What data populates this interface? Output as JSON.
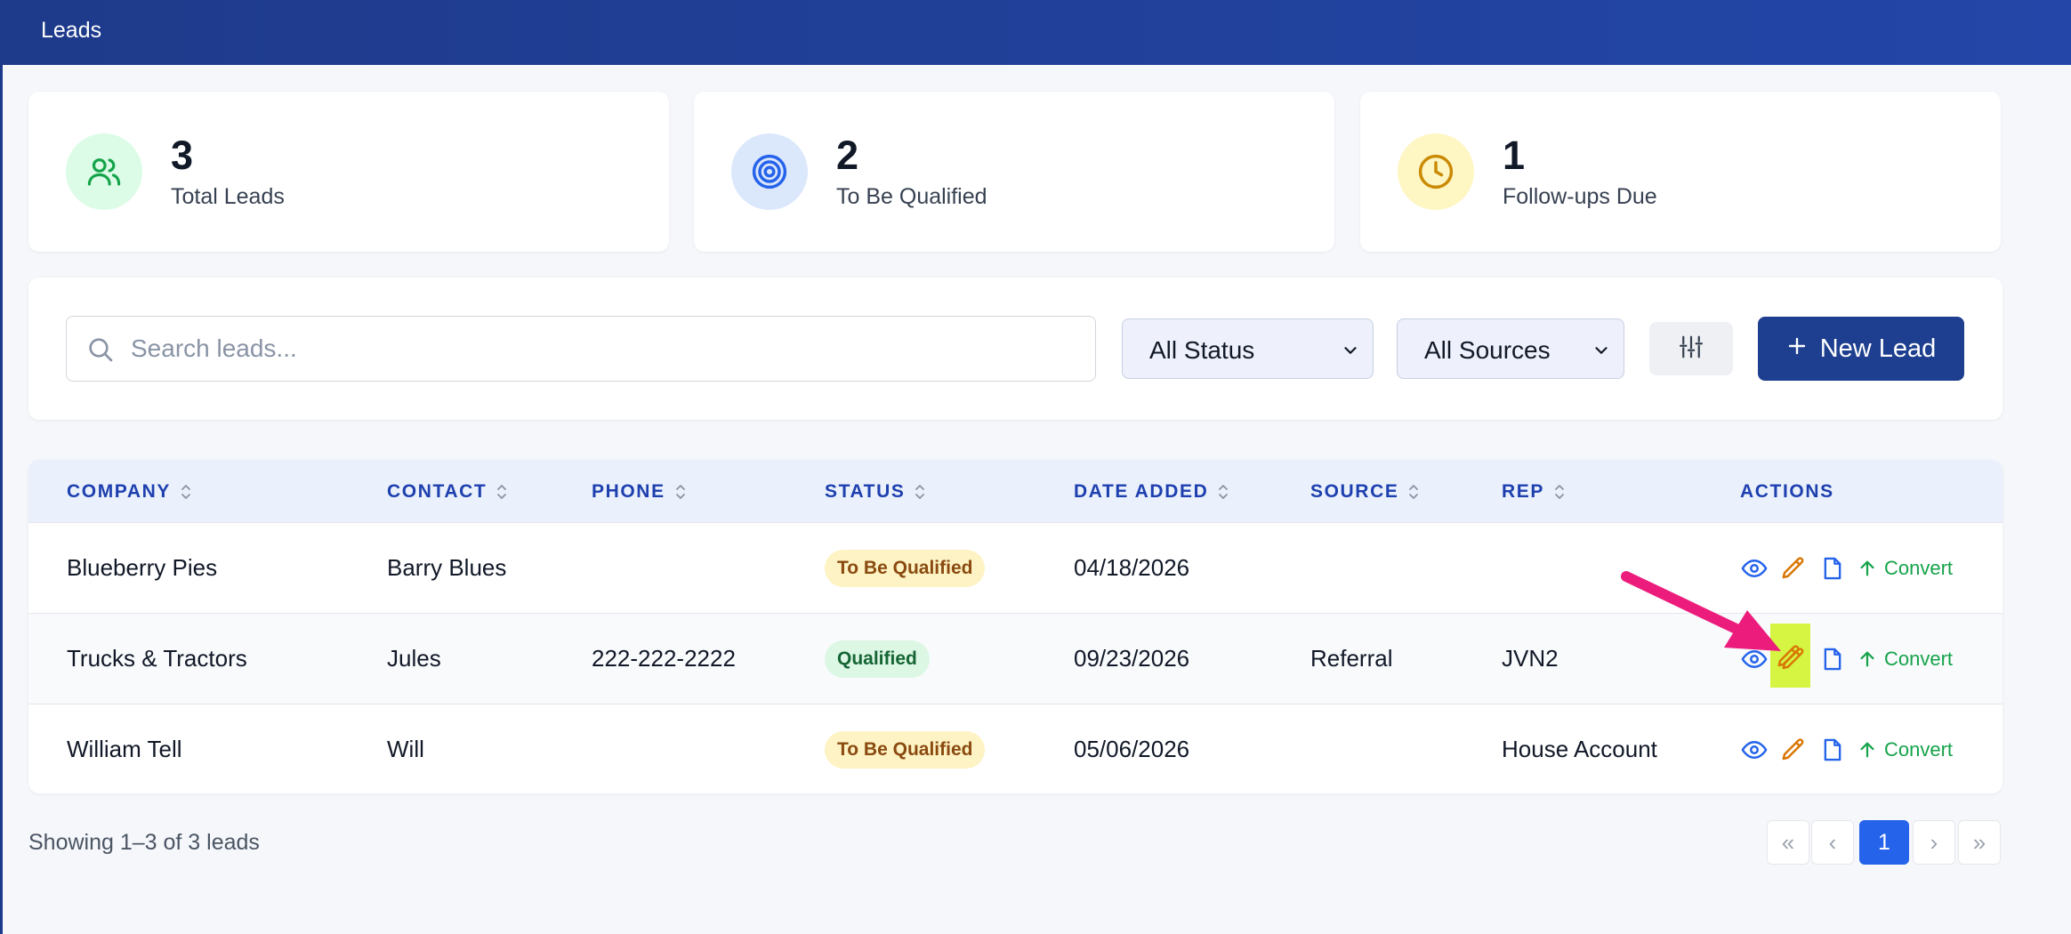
{
  "header": {
    "title": "Leads"
  },
  "stats": [
    {
      "value": "3",
      "label": "Total Leads",
      "icon": "users-icon",
      "bg": "#dcfce7",
      "fg": "#16a34a"
    },
    {
      "value": "2",
      "label": "To Be Qualified",
      "icon": "target-icon",
      "bg": "#dbe7fb",
      "fg": "#2563eb"
    },
    {
      "value": "1",
      "label": "Follow-ups Due",
      "icon": "clock-icon",
      "bg": "#fef6c3",
      "fg": "#ca8a04"
    }
  ],
  "filters": {
    "search_placeholder": "Search leads...",
    "status_selected": "All Status",
    "source_selected": "All Sources",
    "new_lead_label": "New Lead"
  },
  "table": {
    "columns": [
      "COMPANY",
      "CONTACT",
      "PHONE",
      "STATUS",
      "DATE ADDED",
      "SOURCE",
      "REP",
      "ACTIONS"
    ],
    "rows": [
      {
        "company": "Blueberry Pies",
        "contact": "Barry Blues",
        "phone": "",
        "status": "To Be Qualified",
        "date": "04/18/2026",
        "source": "",
        "rep": "",
        "convert": "Convert"
      },
      {
        "company": "Trucks & Tractors",
        "contact": "Jules",
        "phone": "222-222-2222",
        "status": "Qualified",
        "date": "09/23/2026",
        "source": "Referral",
        "rep": "JVN2",
        "convert": "Convert"
      },
      {
        "company": "William Tell",
        "contact": "Will",
        "phone": "",
        "status": "To Be Qualified",
        "date": "05/06/2026",
        "source": "",
        "rep": "House Account",
        "convert": "Convert"
      }
    ]
  },
  "footer": {
    "summary": "Showing 1–3 of 3 leads",
    "pager": {
      "first": "«",
      "prev": "‹",
      "current": "1",
      "next": "›",
      "last": "»"
    }
  },
  "colors": {
    "header": "#1e3a8a",
    "primary_button": "#1e3f8f",
    "column_header_text": "#1e40af",
    "convert": "#16a34a",
    "edit_icon": "#d97706",
    "highlight": "#d6f542",
    "annotation_arrow": "#ec1c7c"
  }
}
